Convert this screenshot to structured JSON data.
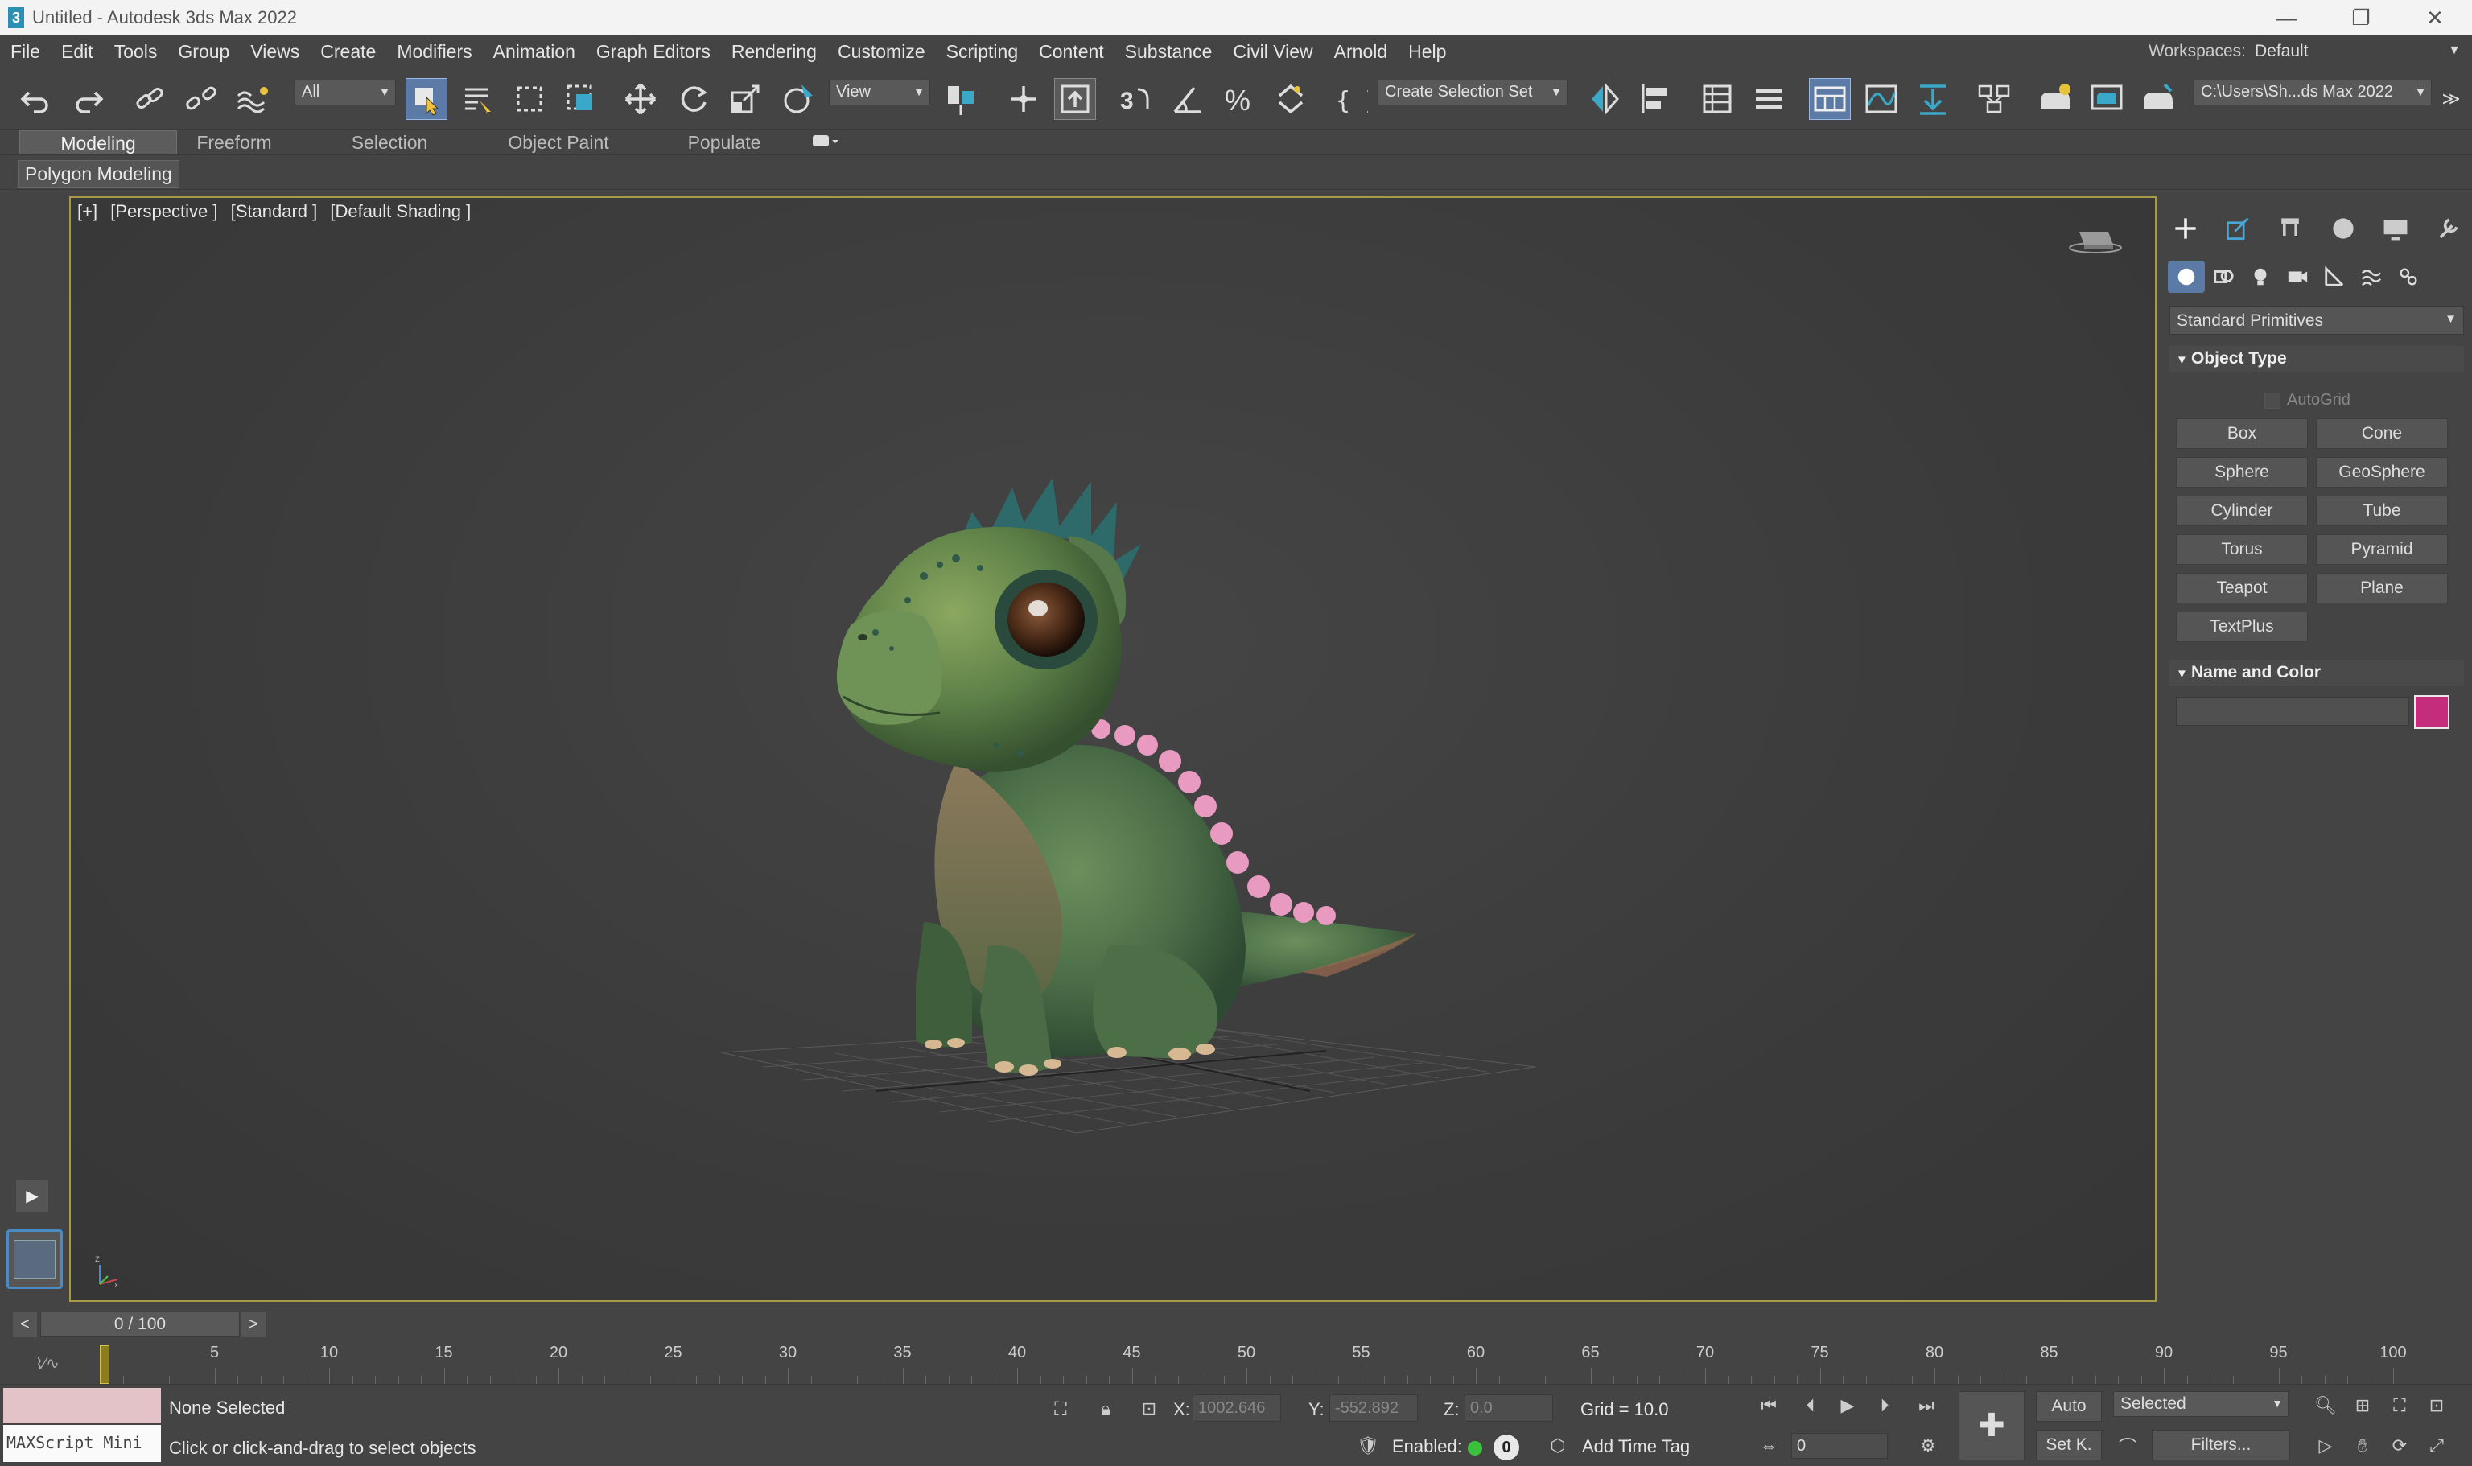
{
  "titlebar": {
    "title": "Untitled - Autodesk 3ds Max 2022",
    "app_icon": "3",
    "minimize": "—",
    "restore": "❐",
    "close": "✕"
  },
  "menu": {
    "items": [
      "File",
      "Edit",
      "Tools",
      "Group",
      "Views",
      "Create",
      "Modifiers",
      "Animation",
      "Graph Editors",
      "Rendering",
      "Customize",
      "Scripting",
      "Content",
      "Substance",
      "Civil View",
      "Arnold",
      "Help"
    ],
    "workspaces_label": "Workspaces:",
    "workspaces_value": "Default"
  },
  "toolbar": {
    "filter_value": "All",
    "ref_coord_value": "View",
    "named_selection_value": "Create Selection Set",
    "project_path": "C:\\Users\\Sh...ds Max 2022",
    "overflow": "≫"
  },
  "ribbon": {
    "tabs": [
      "Modeling",
      "Freeform",
      "Selection",
      "Object Paint",
      "Populate"
    ],
    "panel_label": "Polygon Modeling"
  },
  "viewport": {
    "labels": [
      "[+]",
      "[Perspective ]",
      "[Standard ]",
      "[Default Shading ]"
    ],
    "axis_z": "z",
    "axis_x": "x"
  },
  "command_panel": {
    "category": "Standard Primitives",
    "object_type_title": "Object Type",
    "autogrid": "AutoGrid",
    "buttons": [
      "Box",
      "Cone",
      "Sphere",
      "GeoSphere",
      "Cylinder",
      "Tube",
      "Torus",
      "Pyramid",
      "Teapot",
      "Plane",
      "TextPlus"
    ],
    "name_color_title": "Name and Color",
    "object_color": "#c32d7b"
  },
  "time": {
    "prev": "<",
    "next": ">",
    "current": "0 / 100",
    "ticks": [
      "5",
      "10",
      "15",
      "20",
      "25",
      "30",
      "35",
      "40",
      "45",
      "50",
      "55",
      "60",
      "65",
      "70",
      "75",
      "80",
      "85",
      "90",
      "95",
      "100"
    ]
  },
  "status": {
    "maxscript": "MAXScript Mini",
    "selection": "None Selected",
    "prompt": "Click or click-and-drag to select objects",
    "x_label": "X:",
    "x_value": "1002.646",
    "y_label": "Y:",
    "y_value": "-552.892",
    "z_label": "Z:",
    "z_value": "0.0",
    "grid": "Grid = 10.0",
    "enabled": "Enabled:",
    "enabled_count": "0",
    "add_time_tag": "Add Time Tag",
    "auto": "Auto",
    "set_key": "Set K.",
    "key_filter_value": "Selected",
    "filters": "Filters...",
    "frame_value": "0"
  }
}
